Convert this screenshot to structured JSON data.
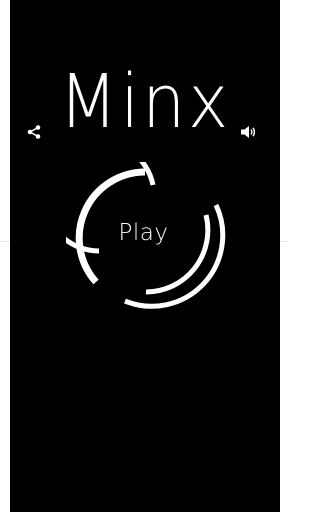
{
  "app": {
    "title": "Minx",
    "play_label": "Play"
  },
  "icons": {
    "share": "share-icon",
    "sound": "speaker-icon"
  },
  "colors": {
    "background": "#000000",
    "foreground": "#ffffff"
  }
}
